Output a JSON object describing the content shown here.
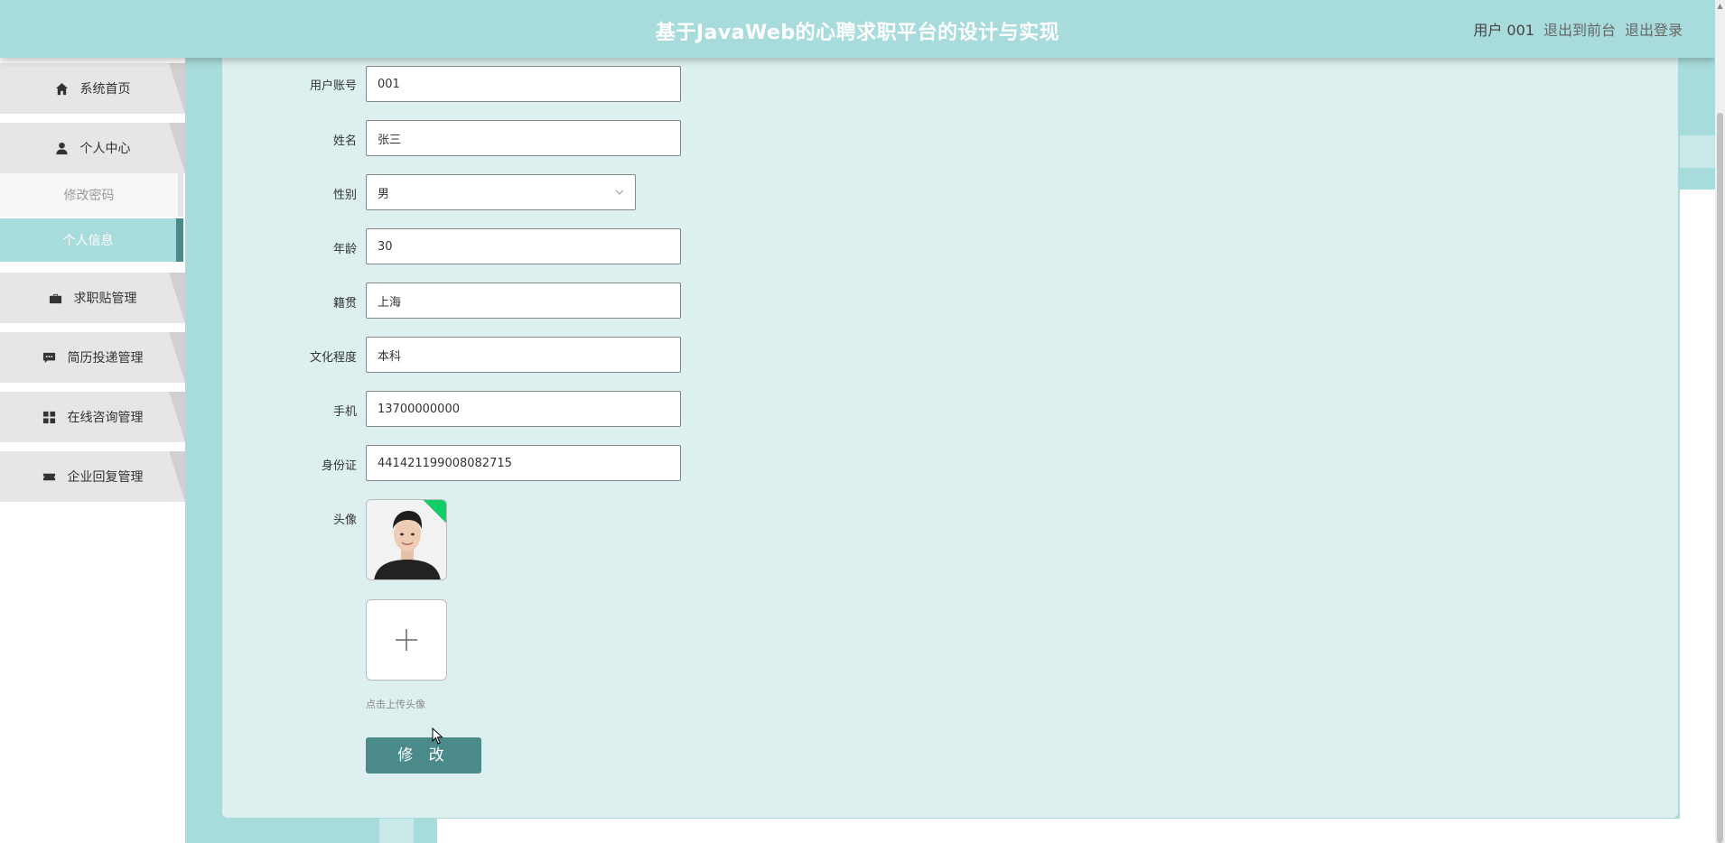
{
  "header": {
    "title": "基于JavaWeb的心聘求职平台的设计与实现",
    "user_label": "用户 001",
    "to_front_label": "退出到前台",
    "logout_label": "退出登录",
    "bg_color": "#a8dcdc"
  },
  "sidebar": {
    "items": [
      {
        "label": "系统首页",
        "icon": "home-icon"
      },
      {
        "label": "个人中心",
        "icon": "user-icon"
      },
      {
        "label": "求职贴管理",
        "icon": "briefcase-icon"
      },
      {
        "label": "简历投递管理",
        "icon": "message-icon"
      },
      {
        "label": "在线咨询管理",
        "icon": "grid-icon"
      },
      {
        "label": "企业回复管理",
        "icon": "ticket-icon"
      }
    ],
    "sub_items": [
      {
        "label": "修改密码"
      },
      {
        "label": "个人信息"
      }
    ],
    "active_color": "#a8dcdc",
    "active_border_color": "#4a8a8a"
  },
  "form": {
    "account": {
      "label": "用户账号",
      "value": "001"
    },
    "name": {
      "label": "姓名",
      "value": "张三"
    },
    "gender": {
      "label": "性别",
      "value": "男"
    },
    "age": {
      "label": "年龄",
      "value": "30"
    },
    "hometown": {
      "label": "籍贯",
      "value": "上海"
    },
    "education": {
      "label": "文化程度",
      "value": "本科"
    },
    "phone": {
      "label": "手机",
      "value": "13700000000"
    },
    "id_card": {
      "label": "身份证",
      "value": "441421199008082715"
    },
    "avatar": {
      "label": "头像",
      "upload_tip": "点击上传头像"
    },
    "submit_label": "修 改",
    "submit_color": "#4a8a8a"
  }
}
